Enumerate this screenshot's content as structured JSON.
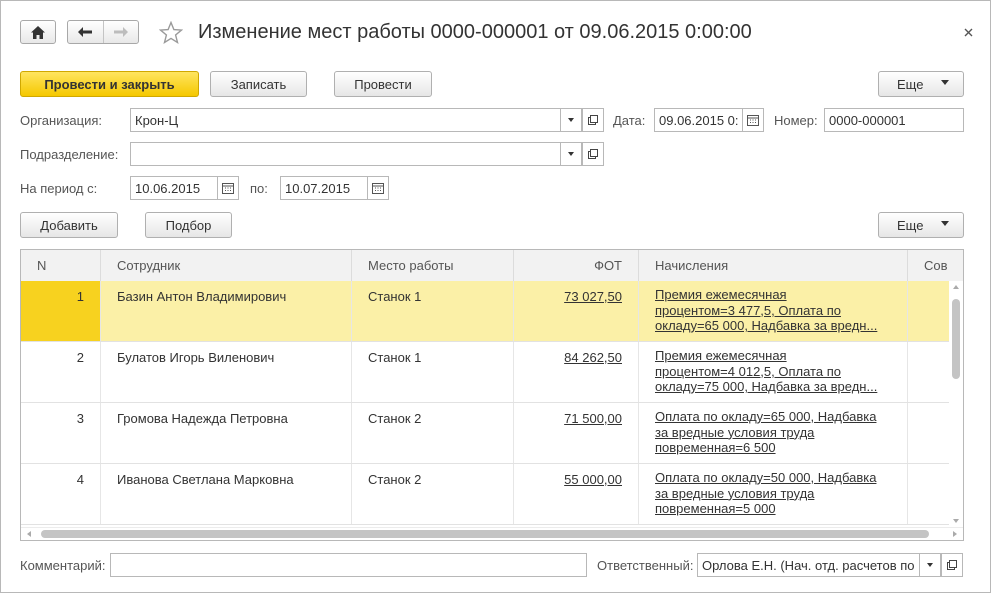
{
  "window": {
    "title": "Изменение мест работы 0000-000001 от 09.06.2015 0:00:00"
  },
  "toolbar": {
    "post_close": "Провести и закрыть",
    "save": "Записать",
    "post": "Провести",
    "more": "Еще"
  },
  "form": {
    "org_label": "Организация:",
    "org_value": "Крон-Ц",
    "date_label": "Дата:",
    "date_value": "09.06.2015  0:",
    "number_label": "Номер:",
    "number_value": "0000-000001",
    "dept_label": "Подразделение:",
    "dept_value": "",
    "period_label": "На период с:",
    "period_from": "10.06.2015",
    "period_to_label": "по:",
    "period_to": "10.07.2015"
  },
  "table_toolbar": {
    "add": "Добавить",
    "select": "Подбор",
    "more": "Еще"
  },
  "table": {
    "columns": [
      "N",
      "Сотрудник",
      "Место работы",
      "ФОТ",
      "Начисления",
      "Сов"
    ],
    "rows": [
      {
        "n": "1",
        "employee": "Базин Антон Владимирович",
        "place": "Станок 1",
        "fot": "73 027,50",
        "accruals": [
          "Премия ежемесячная",
          "процентом=3 477,5, Оплата по",
          "окладу=65 000, Надбавка за вредн..."
        ]
      },
      {
        "n": "2",
        "employee": "Булатов Игорь Виленович",
        "place": "Станок 1",
        "fot": "84 262,50",
        "accruals": [
          "Премия ежемесячная",
          "процентом=4 012,5, Оплата по",
          "окладу=75 000, Надбавка за вредн..."
        ]
      },
      {
        "n": "3",
        "employee": "Громова Надежда Петровна",
        "place": "Станок 2",
        "fot": "71 500,00",
        "accruals": [
          "Оплата по окладу=65 000, Надбавка",
          "за вредные условия труда",
          "повременная=6 500"
        ]
      },
      {
        "n": "4",
        "employee": "Иванова Светлана Марковна",
        "place": "Станок 2",
        "fot": "55 000,00",
        "accruals": [
          "Оплата по окладу=50 000, Надбавка",
          "за вредные условия труда",
          "повременная=5 000"
        ]
      }
    ]
  },
  "footer": {
    "comment_label": "Комментарий:",
    "comment_value": "",
    "responsible_label": "Ответственный:",
    "responsible_value": "Орлова Е.Н. (Нач. отд. расчетов по"
  }
}
